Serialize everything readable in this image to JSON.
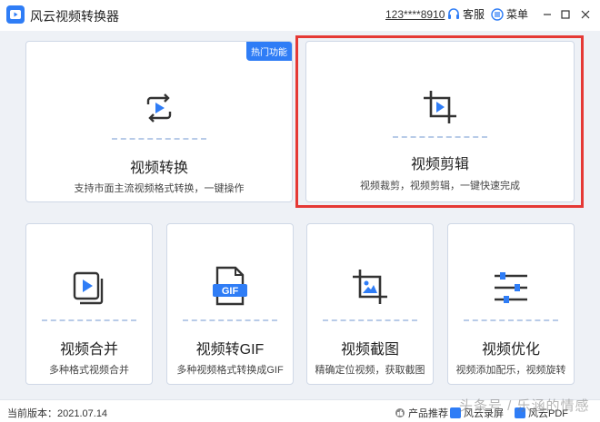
{
  "app": {
    "title": "风云视频转换器",
    "account": "123****8910",
    "service_label": "客服",
    "menu_label": "菜单"
  },
  "colors": {
    "accent": "#2f7df6",
    "highlight": "#e53935"
  },
  "cards": {
    "convert": {
      "title": "视频转换",
      "desc": "支持市面主流视频格式转换，一键操作",
      "badge": "热门功能",
      "icon": "convert-icon"
    },
    "edit": {
      "title": "视频剪辑",
      "desc": "视频裁剪，视频剪辑，一键快速完成",
      "icon": "crop-icon"
    },
    "merge": {
      "title": "视频合并",
      "desc": "多种格式视频合并",
      "icon": "merge-icon"
    },
    "gif": {
      "title": "视频转GIF",
      "desc": "多种视频格式转换成GIF",
      "icon_text": "GIF",
      "icon": "gif-file-icon"
    },
    "screenshot": {
      "title": "视频截图",
      "desc": "精确定位视频，获取截图",
      "icon": "crop-image-icon"
    },
    "optimize": {
      "title": "视频优化",
      "desc": "视频添加配乐，视频旋转",
      "icon": "sliders-icon"
    }
  },
  "status": {
    "version_label": "当前版本：",
    "version": "2021.07.14",
    "recommend_label": "产品推荐：",
    "rec1": "风云录屏",
    "rec2": "风云PDF"
  },
  "watermark": "头条号 / 乐涵的情感"
}
